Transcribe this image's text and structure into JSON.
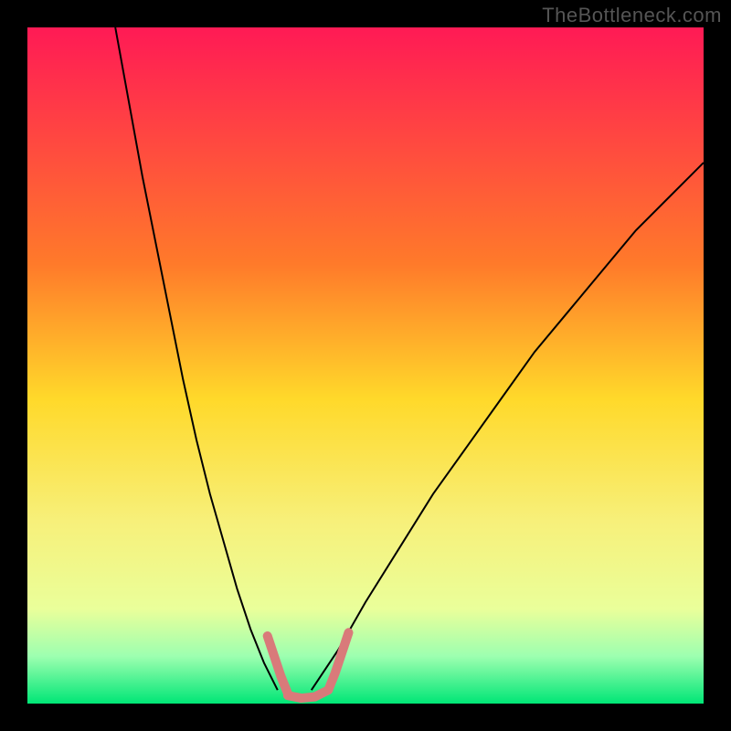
{
  "watermark": "TheBottleneck.com",
  "chart_data": {
    "type": "line",
    "title": "",
    "xlabel": "",
    "ylabel": "",
    "x_range": [
      0,
      100
    ],
    "y_range": [
      0,
      100
    ],
    "gradient_stops": [
      {
        "offset": 0,
        "color": "#ff1a55"
      },
      {
        "offset": 35,
        "color": "#ff7a2a"
      },
      {
        "offset": 55,
        "color": "#ffd92a"
      },
      {
        "offset": 73,
        "color": "#f7f07a"
      },
      {
        "offset": 86,
        "color": "#eaff9a"
      },
      {
        "offset": 93,
        "color": "#9dffb0"
      },
      {
        "offset": 100,
        "color": "#00e676"
      }
    ],
    "series": [
      {
        "name": "left-curve",
        "color": "#000000",
        "width": 2,
        "x": [
          13,
          15,
          17,
          19,
          21,
          23,
          25,
          27,
          29,
          31,
          33,
          35,
          37
        ],
        "y": [
          100,
          89,
          78,
          68,
          58,
          48,
          39,
          31,
          24,
          17,
          11,
          6,
          2
        ]
      },
      {
        "name": "right-curve",
        "color": "#000000",
        "width": 2,
        "x": [
          42,
          46,
          50,
          55,
          60,
          65,
          70,
          75,
          80,
          85,
          90,
          95,
          100
        ],
        "y": [
          2,
          8,
          15,
          23,
          31,
          38,
          45,
          52,
          58,
          64,
          70,
          75,
          80
        ]
      },
      {
        "name": "marker-left",
        "color": "#d97a7a",
        "width": 10,
        "linecap": "round",
        "x": [
          35.5,
          36.5,
          37.5,
          38.5
        ],
        "y": [
          10,
          7,
          4,
          1.5
        ]
      },
      {
        "name": "marker-bottom",
        "color": "#d97a7a",
        "width": 10,
        "linecap": "round",
        "x": [
          38.5,
          40.5,
          42.5,
          44.5
        ],
        "y": [
          1.2,
          0.8,
          1.0,
          2.0
        ]
      },
      {
        "name": "marker-right",
        "color": "#d97a7a",
        "width": 10,
        "linecap": "round",
        "x": [
          44.5,
          45.5,
          46.5,
          47.5
        ],
        "y": [
          2.0,
          4.5,
          7.5,
          10.5
        ]
      }
    ]
  }
}
